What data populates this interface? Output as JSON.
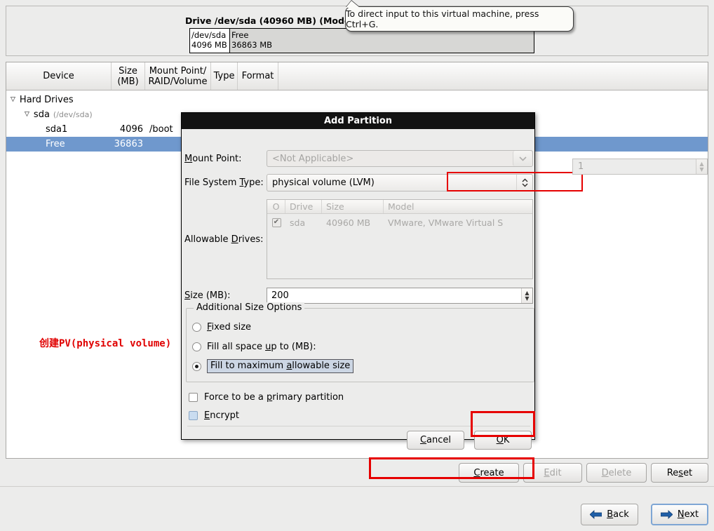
{
  "drive_panel": {
    "title": "Drive /dev/sda (40960 MB) (Model:",
    "segments": [
      {
        "name": "/dev/sda",
        "size": "4096 MB"
      },
      {
        "name": "Free",
        "size": "36863 MB"
      }
    ]
  },
  "tooltip": {
    "text": "To direct input to this virtual machine, press Ctrl+G."
  },
  "tree": {
    "headers": [
      "Device",
      "Size\n(MB)",
      "Mount Point/\nRAID/Volume",
      "Type",
      "Format"
    ],
    "header_device": "Device",
    "header_size_l1": "Size",
    "header_size_l2": "(MB)",
    "header_mount_l1": "Mount Point/",
    "header_mount_l2": "RAID/Volume",
    "header_type": "Type",
    "header_format": "Format",
    "rows": [
      {
        "device": "Hard Drives",
        "size": "",
        "mount": "",
        "indent": 0,
        "arrow": "▽",
        "sub": ""
      },
      {
        "device": "sda",
        "size": "",
        "mount": "",
        "indent": 1,
        "arrow": "▽",
        "sub": "(/dev/sda)"
      },
      {
        "device": "sda1",
        "size": "4096",
        "mount": "/boot",
        "indent": 2,
        "arrow": "",
        "sub": ""
      },
      {
        "device": "Free",
        "size": "36863",
        "mount": "",
        "indent": 2,
        "arrow": "",
        "sub": "",
        "selected": true
      }
    ]
  },
  "annotation": {
    "text": "创建PV(physical volume)",
    "color": "#e00000"
  },
  "actions": {
    "create": "Create",
    "edit": "Edit",
    "delete": "Delete",
    "reset": "Reset",
    "back": "Back",
    "next": "Next"
  },
  "dialog": {
    "title": "Add Partition",
    "mount_point_label": "Mount Point:",
    "mount_point_label_pre": "M",
    "mount_point_label_mid": "ount Point:",
    "mount_point_value": "<Not Applicable>",
    "fs_type_label_a": "File System ",
    "fs_type_label_u": "T",
    "fs_type_label_b": "ype:",
    "fs_type_value": "physical volume (LVM)",
    "allowable_label_a": "Allowable ",
    "allowable_label_u": "D",
    "allowable_label_b": "rives:",
    "drives_headers": {
      "check": "O",
      "drive": "Drive",
      "size": "Size",
      "model": "Model"
    },
    "drive_row": {
      "checked": "✔",
      "drive": "sda",
      "size": "40960 MB",
      "model": "VMware, VMware Virtual S"
    },
    "size_label_u": "S",
    "size_label_b": "ize (MB):",
    "size_value": "200",
    "aso_legend": "Additional Size Options",
    "radio_fixed_u": "F",
    "radio_fixed_b": "ixed size",
    "radio_fillto_a": "Fill all space ",
    "radio_fillto_u": "u",
    "radio_fillto_b": "p to (MB):",
    "fillto_value": "1",
    "radio_max_a": "Fill to maximum ",
    "radio_max_u": "a",
    "radio_max_b": "llowable size",
    "chk_primary_a": "Force to be a ",
    "chk_primary_u": "p",
    "chk_primary_b": "rimary partition",
    "chk_encrypt_u": "E",
    "chk_encrypt_b": "ncrypt",
    "cancel_u": "C",
    "cancel_b": "ancel",
    "ok_u": "O",
    "ok_b": "K"
  },
  "colors": {
    "selection_blue": "#6f98cd",
    "highlight_red": "#e60000",
    "annotation_red": "#e00000",
    "focus_blue": "#7ea6d4",
    "arrow_blue": "#1f5fa8"
  }
}
